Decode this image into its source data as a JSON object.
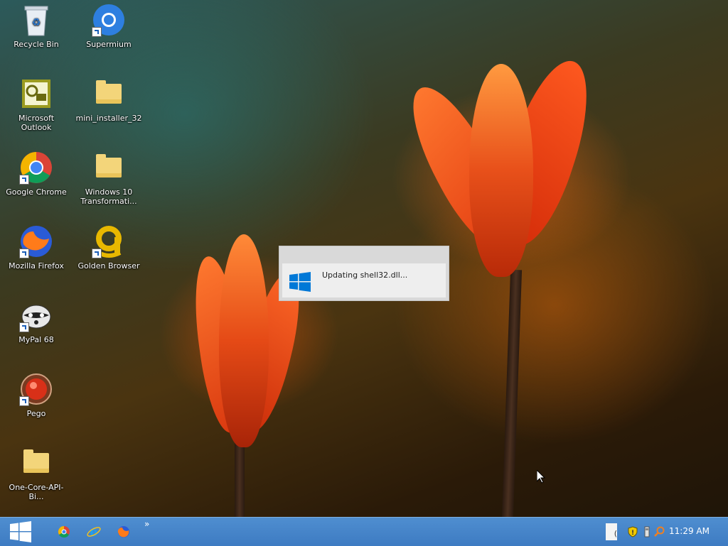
{
  "desktop": {
    "icons": [
      {
        "label": "Recycle Bin"
      },
      {
        "label": "Supermium"
      },
      {
        "label": "Microsoft Outlook"
      },
      {
        "label": "mini_installer_32"
      },
      {
        "label": "Google Chrome"
      },
      {
        "label": "Windows 10 Transformati..."
      },
      {
        "label": "Mozilla Firefox"
      },
      {
        "label": "Golden Browser"
      },
      {
        "label": "MyPal 68"
      },
      {
        "label": "Pego"
      },
      {
        "label": "One-Core-API-Bi..."
      }
    ]
  },
  "popup": {
    "message": "Updating shell32.dll..."
  },
  "taskbar": {
    "overflow": "»",
    "clock": "11:29 AM",
    "input_indicator": "("
  },
  "colors": {
    "taskbar": "#3d7bc2",
    "accent": "#0078d7"
  }
}
